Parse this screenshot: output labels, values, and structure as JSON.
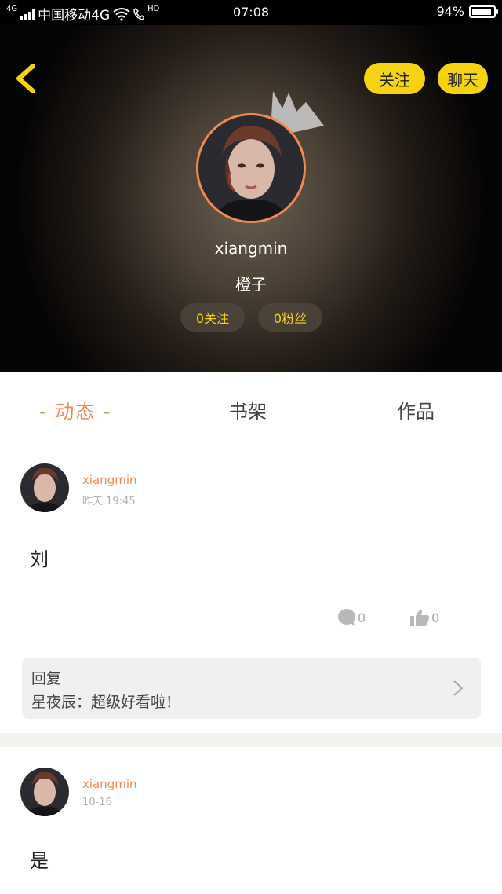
{
  "status_bar": {
    "network_tag": "4G",
    "carrier": "中国移动4G",
    "hd_label": "HD",
    "time": "07:08",
    "battery": "94%",
    "battery_level": 0.94
  },
  "profile": {
    "follow_label": "关注",
    "chat_label": "聊天",
    "username": "xiangmin",
    "nickname": "橙子",
    "follows_count": "0关注",
    "fans_count": "0粉丝"
  },
  "tabs": [
    {
      "label": "- 动态 -",
      "active": true
    },
    {
      "label": "书架",
      "active": false
    },
    {
      "label": "作品",
      "active": false
    }
  ],
  "posts": [
    {
      "username": "xiangmin",
      "time": "昨天 19:45",
      "content": "刘",
      "comments": "0",
      "likes": "0",
      "reply": {
        "title": "回复",
        "content": "星夜辰：超级好看啦！"
      }
    },
    {
      "username": "xiangmin",
      "time": "10-16",
      "content": "是"
    }
  ],
  "colors": {
    "accent_orange": "#f08a53",
    "button_yellow": "#f5d313",
    "header_dark": "#050404"
  },
  "icons": [
    "back-arrow-icon",
    "crown-icon",
    "comment-icon",
    "thumbs-up-icon",
    "chevron-right-icon",
    "wifi-icon",
    "battery-icon"
  ]
}
